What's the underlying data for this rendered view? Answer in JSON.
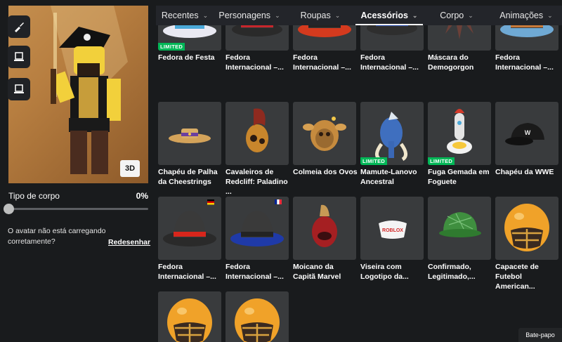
{
  "tabs": [
    {
      "label": "Recentes"
    },
    {
      "label": "Personagens"
    },
    {
      "label": "Roupas"
    },
    {
      "label": "Acessórios",
      "active": true
    },
    {
      "label": "Corpo"
    },
    {
      "label": "Animações"
    }
  ],
  "side_buttons": [
    "brush-icon",
    "laptop-icon",
    "laptop-icon"
  ],
  "avatar": {
    "view_toggle": "3D"
  },
  "body_type": {
    "label": "Tipo de corpo",
    "value": "0%",
    "level": 0
  },
  "loading_note": "O avatar não está carregando corretamente?",
  "redraw_link": "Redesenhar",
  "items": [
    {
      "name": "Fedora de Festa",
      "limited": "LIMITED",
      "thumb": "fedora-party"
    },
    {
      "name": "Fedora Internacional –...",
      "thumb": "fedora-red-flag-us"
    },
    {
      "name": "Fedora Internacional –...",
      "thumb": "fedora-orange"
    },
    {
      "name": "Fedora Internacional –...",
      "thumb": "fedora-yellow-blue"
    },
    {
      "name": "Máscara do Demogorgon",
      "thumb": "demogorgon"
    },
    {
      "name": "Fedora Internacional –...",
      "thumb": "fedora-blue"
    },
    {
      "name": "Chapéu de Palha da Cheestrings",
      "thumb": "straw-hat"
    },
    {
      "name": "Cavaleiros de Redcliff: Paladino ...",
      "thumb": "helmet-red"
    },
    {
      "name": "Colmeia dos Ovos",
      "thumb": "beehive"
    },
    {
      "name": "Mamute-Lanovo Ancestral",
      "limited": "LIMITED",
      "thumb": "mammoth"
    },
    {
      "name": "Fuga Gemada em Foguete",
      "limited": "LIMITED",
      "thumb": "rocket-egg"
    },
    {
      "name": "Chapéu da WWE",
      "thumb": "wwe-cap"
    },
    {
      "name": "Fedora Internacional –...",
      "thumb": "fedora-red-flag-de"
    },
    {
      "name": "Fedora Internacional –...",
      "thumb": "fedora-blue-flag-fr"
    },
    {
      "name": "Moicano da Capitã Marvel",
      "thumb": "mohawk"
    },
    {
      "name": "Viseira com Logotipo da...",
      "visor_text": "ROBLOX",
      "thumb": "visor"
    },
    {
      "name": "Confirmado, Legitimado,...",
      "thumb": "green-cap"
    },
    {
      "name": "Capacete de Futebol American...",
      "thumb": "football-helmet"
    },
    {
      "name": "",
      "thumb": "football-helmet"
    },
    {
      "name": "",
      "thumb": "football-helmet"
    }
  ],
  "chat_button": "Bate-papo",
  "colors": {
    "background": "#191b1d",
    "card": "#393b3d",
    "tab_bar": "#23252a",
    "limited": "#02b757"
  }
}
